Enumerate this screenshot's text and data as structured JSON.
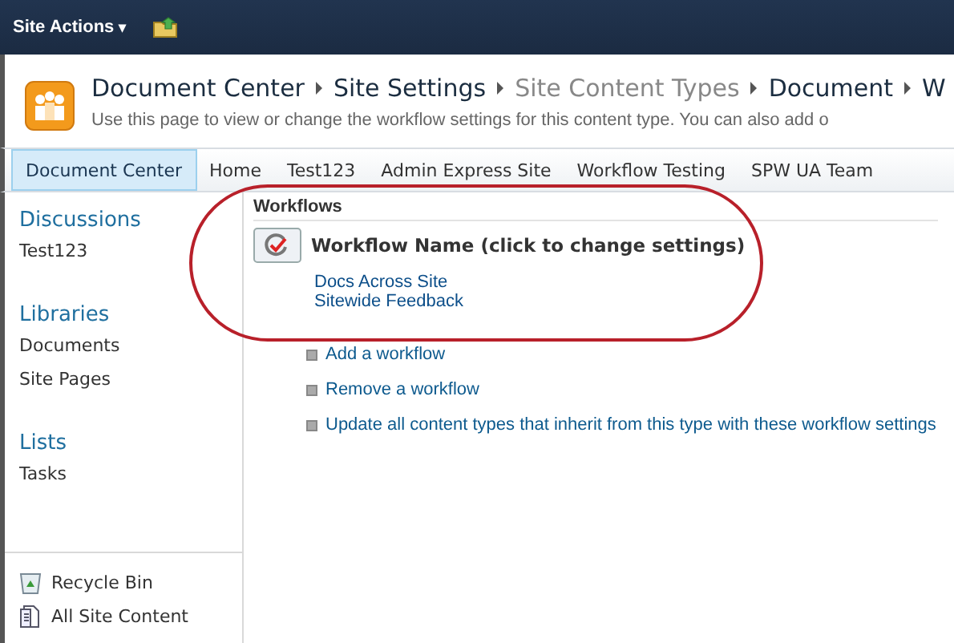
{
  "top_bar": {
    "site_actions": "Site Actions",
    "caret": "▾"
  },
  "header": {
    "breadcrumb": [
      {
        "label": "Document Center",
        "current": false
      },
      {
        "label": "Site Settings",
        "current": false
      },
      {
        "label": "Site Content Types",
        "current": true
      },
      {
        "label": "Document",
        "current": false
      },
      {
        "label": "W",
        "current": false
      }
    ],
    "description": "Use this page to view or change the workflow settings for this content type. You can also add o"
  },
  "nav_tabs": [
    {
      "label": "Document Center",
      "selected": true
    },
    {
      "label": "Home",
      "selected": false
    },
    {
      "label": "Test123",
      "selected": false
    },
    {
      "label": "Admin Express Site",
      "selected": false
    },
    {
      "label": "Workflow Testing",
      "selected": false
    },
    {
      "label": "SPW UA Team",
      "selected": false
    }
  ],
  "sidebar": {
    "groups": [
      {
        "heading": "Discussions",
        "items": [
          "Test123"
        ]
      },
      {
        "heading": "Libraries",
        "items": [
          "Documents",
          "Site Pages"
        ]
      },
      {
        "heading": "Lists",
        "items": [
          "Tasks"
        ]
      }
    ],
    "footer": [
      {
        "kind": "recycle",
        "label": "Recycle Bin"
      },
      {
        "kind": "content",
        "label": "All Site Content"
      }
    ]
  },
  "workflows": {
    "heading": "Workflows",
    "column": "Workflow Name (click to change settings)",
    "items": [
      "Docs Across Site",
      "Sitewide Feedback"
    ],
    "actions": [
      "Add a workflow",
      "Remove a workflow",
      "Update all content types that inherit from this type with these workflow settings"
    ]
  }
}
